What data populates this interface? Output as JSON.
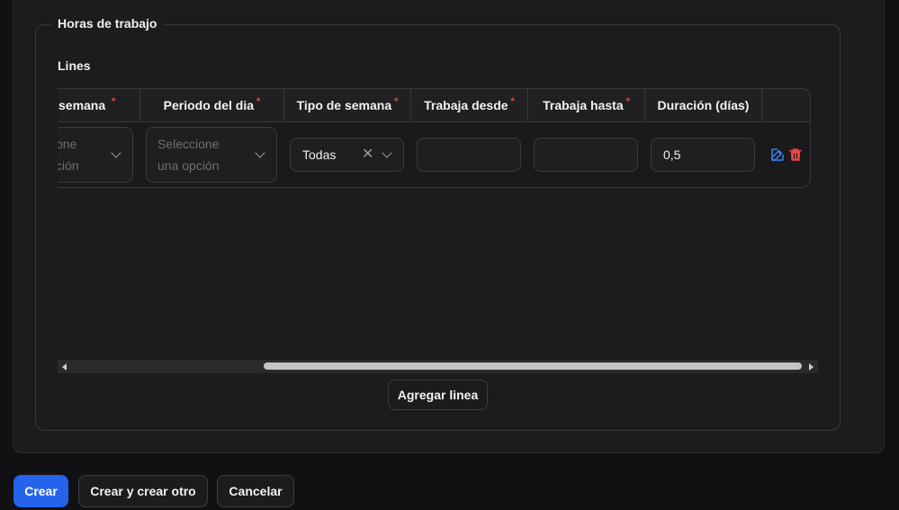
{
  "section": {
    "legend": "Horas de trabajo",
    "lines_label": "Lines"
  },
  "table": {
    "columns": [
      {
        "label": "Día de la semana",
        "visible_label": "semana",
        "required": true
      },
      {
        "label": "Periodo del dia",
        "required": true
      },
      {
        "label": "Tipo de semana",
        "required": true
      },
      {
        "label": "Trabaja desde",
        "required": true
      },
      {
        "label": "Trabaja hasta",
        "required": true
      },
      {
        "label": "Duración (días)",
        "required": false
      }
    ],
    "row": {
      "day_placeholder_line1": "one",
      "day_placeholder_line2": "ción",
      "period_placeholder_line1": "Seleccione",
      "period_placeholder_line2": "una opción",
      "week_type_value": "Todas",
      "works_from_value": "",
      "works_until_value": "",
      "duration_value": "0,5"
    }
  },
  "add_line_label": "Agregar linea",
  "footer": {
    "create_label": "Crear",
    "create_another_label": "Crear y crear otro",
    "cancel_label": "Cancelar"
  },
  "required_mark": "*",
  "colors": {
    "primary": "#2563eb",
    "danger": "#ef4444",
    "edit": "#3b82f6"
  },
  "icons": [
    "chevron-down-icon",
    "clear-icon",
    "edit-icon",
    "trash-icon",
    "scroll-left-icon",
    "scroll-right-icon"
  ]
}
